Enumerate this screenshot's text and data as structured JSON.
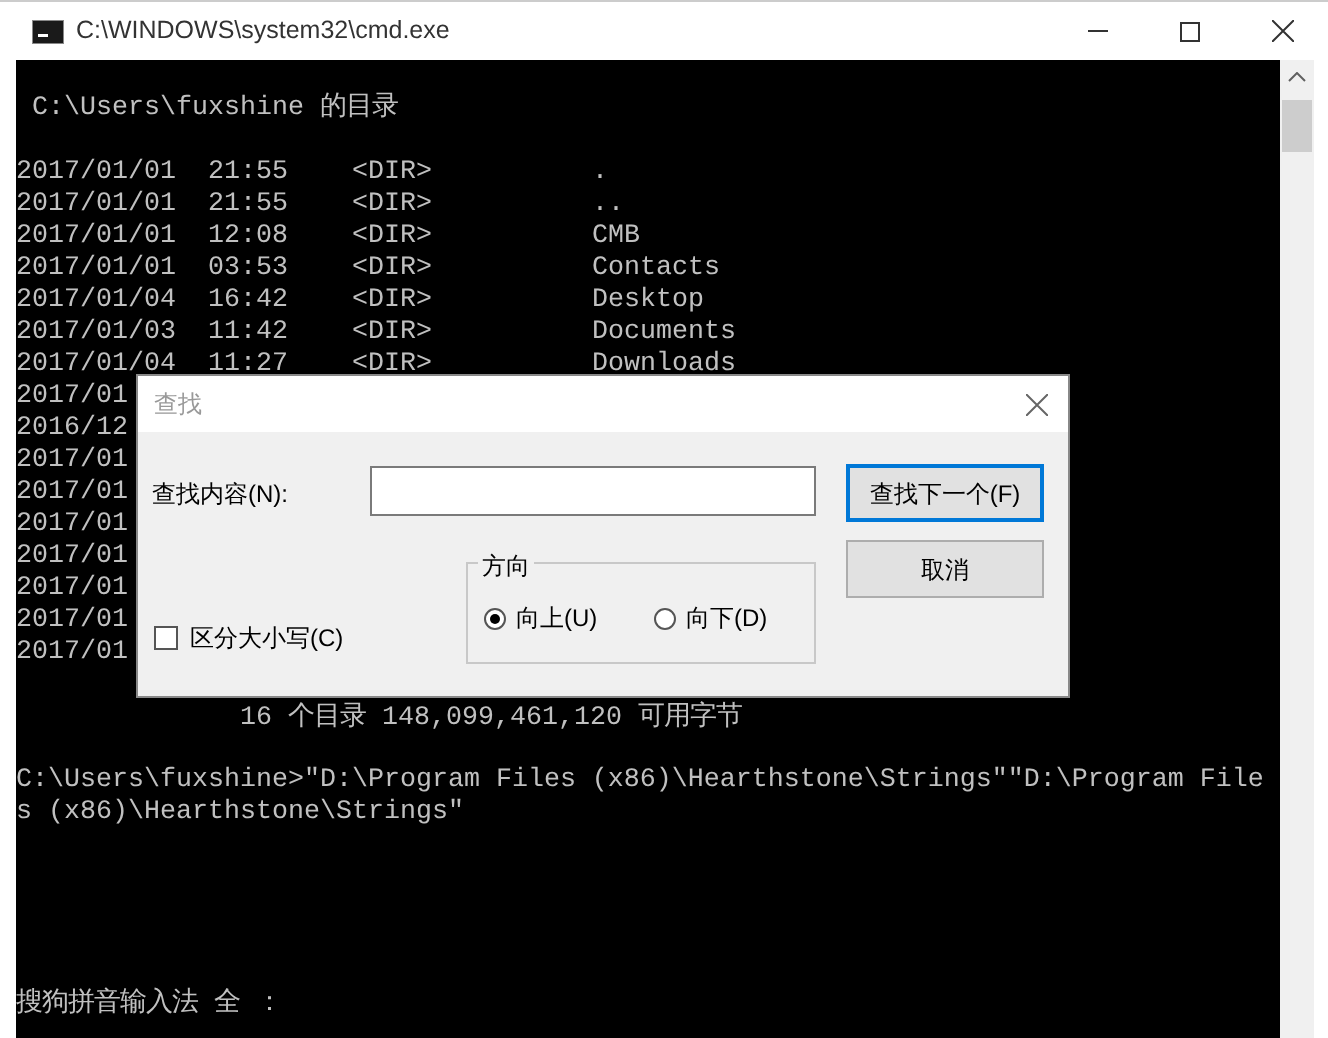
{
  "window": {
    "title": "C:\\WINDOWS\\system32\\cmd.exe"
  },
  "console": {
    "heading": "C:\\Users\\fuxshine 的目录",
    "rows": [
      {
        "date": "2017/01/01",
        "time": "21:55",
        "type": "<DIR>",
        "name": "."
      },
      {
        "date": "2017/01/01",
        "time": "21:55",
        "type": "<DIR>",
        "name": ".."
      },
      {
        "date": "2017/01/01",
        "time": "12:08",
        "type": "<DIR>",
        "name": "CMB"
      },
      {
        "date": "2017/01/01",
        "time": "03:53",
        "type": "<DIR>",
        "name": "Contacts"
      },
      {
        "date": "2017/01/04",
        "time": "16:42",
        "type": "<DIR>",
        "name": "Desktop"
      },
      {
        "date": "2017/01/03",
        "time": "11:42",
        "type": "<DIR>",
        "name": "Documents"
      },
      {
        "date": "2017/01/04",
        "time": "11:27",
        "type": "<DIR>",
        "name": "Downloads"
      },
      {
        "date": "2017/01"
      },
      {
        "date": "2016/12"
      },
      {
        "date": "2017/01"
      },
      {
        "date": "2017/01"
      },
      {
        "date": "2017/01"
      },
      {
        "date": "2017/01"
      },
      {
        "date": "2017/01"
      },
      {
        "date": "2017/01"
      },
      {
        "date": "2017/01"
      }
    ],
    "summary": "16 个目录 148,099,461,120 可用字节",
    "command_lines": [
      "C:\\Users\\fuxshine>\"D:\\Program Files (x86)\\Hearthstone\\Strings\"\"D:\\Program File",
      "s (x86)\\Hearthstone\\Strings\""
    ],
    "ime": "搜狗拼音输入法 全 ："
  },
  "find_dialog": {
    "title": "查找",
    "find_label": "查找内容(N):",
    "buttons": [
      {
        "label": "查找下一个(F)",
        "default": true
      },
      {
        "label": "取消",
        "default": false
      }
    ],
    "direction": {
      "label": "方向",
      "options": [
        {
          "label": "向上(U)",
          "selected": true
        },
        {
          "label": "向下(D)",
          "selected": false
        }
      ]
    },
    "match_case": {
      "label": "区分大小写(C)",
      "checked": false
    }
  }
}
